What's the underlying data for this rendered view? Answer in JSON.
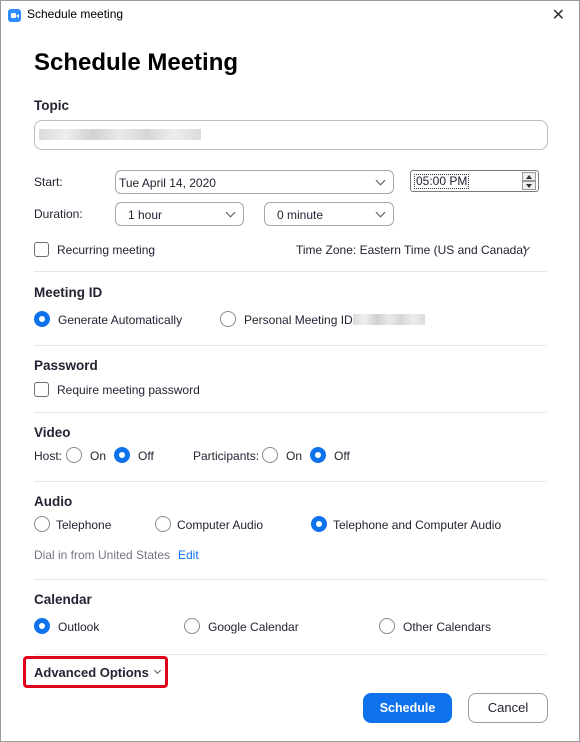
{
  "window": {
    "title": "Schedule meeting",
    "app_icon": "zoom-app-icon",
    "close_glyph": "✕"
  },
  "heading": "Schedule Meeting",
  "topic": {
    "label": "Topic",
    "value": ""
  },
  "start": {
    "label": "Start:",
    "date": "Tue  April 14, 2020",
    "time": "05:00 PM"
  },
  "duration": {
    "label": "Duration:",
    "hours": "1 hour",
    "minutes": "0 minute"
  },
  "recurring": {
    "label": "Recurring meeting",
    "checked": false
  },
  "timezone": {
    "text": "Time Zone: Eastern Time (US and Canada)"
  },
  "meeting_id": {
    "title": "Meeting ID",
    "options": [
      {
        "label": "Generate Automatically",
        "selected": true
      },
      {
        "label": "Personal Meeting ID",
        "selected": false
      }
    ]
  },
  "password": {
    "title": "Password",
    "require_label": "Require meeting password",
    "checked": false
  },
  "video": {
    "title": "Video",
    "host_label": "Host:",
    "participants_label": "Participants:",
    "on_label": "On",
    "off_label": "Off",
    "host": "Off",
    "participants": "Off"
  },
  "audio": {
    "title": "Audio",
    "options": [
      {
        "label": "Telephone",
        "selected": false
      },
      {
        "label": "Computer Audio",
        "selected": false
      },
      {
        "label": "Telephone and Computer Audio",
        "selected": true
      }
    ],
    "dial_in_text": "Dial in from United States",
    "edit_label": "Edit"
  },
  "calendar": {
    "title": "Calendar",
    "options": [
      {
        "label": "Outlook",
        "selected": true
      },
      {
        "label": "Google Calendar",
        "selected": false
      },
      {
        "label": "Other Calendars",
        "selected": false
      }
    ]
  },
  "advanced_options": {
    "label": "Advanced Options",
    "highlight_color": "#e0001a"
  },
  "buttons": {
    "schedule": "Schedule",
    "cancel": "Cancel"
  },
  "colors": {
    "accent": "#0e72ed",
    "text": "#232333",
    "muted": "#747487"
  }
}
